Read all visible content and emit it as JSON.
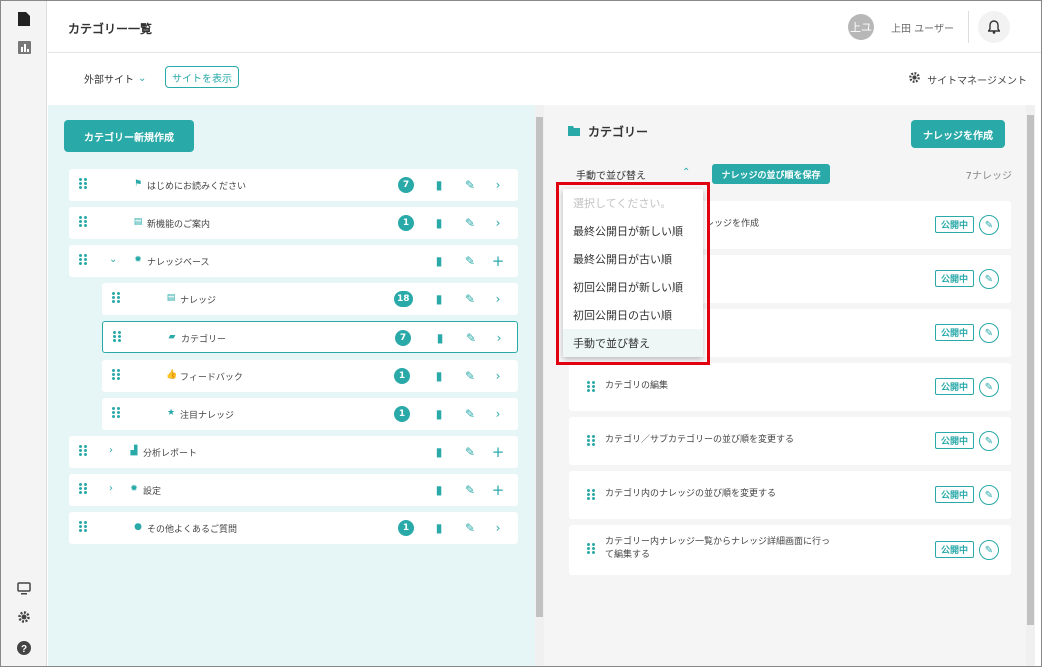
{
  "header": {
    "title": "カテゴリー一覧",
    "avatar_initials": "上ユ",
    "user_name": "上田 ユーザー"
  },
  "subheader": {
    "external_site": "外部サイト",
    "show_site": "サイトを表示",
    "site_management": "サイトマネージメント"
  },
  "left_panel": {
    "new_category_button": "カテゴリー新規作成",
    "tree": [
      {
        "label": "はじめにお読みください",
        "badge": "7",
        "icon": "flag-icon"
      },
      {
        "label": "新機能のご案内",
        "badge": "1",
        "icon": "document-icon"
      },
      {
        "label": "ナレッジベース",
        "badge": "",
        "icon": "gear-icon",
        "expanded": true
      },
      {
        "label": "ナレッジ",
        "badge": "18",
        "icon": "document-icon"
      },
      {
        "label": "カテゴリー",
        "badge": "7",
        "icon": "folder-icon",
        "selected": true
      },
      {
        "label": "フィードバック",
        "badge": "1",
        "icon": "thumbs-up-icon"
      },
      {
        "label": "注目ナレッジ",
        "badge": "1",
        "icon": "star-icon"
      },
      {
        "label": "分析レポート",
        "badge": "",
        "icon": "bar-chart-icon",
        "expanded": false
      },
      {
        "label": "設定",
        "badge": "",
        "icon": "gear-icon",
        "expanded": false
      },
      {
        "label": "その他よくあるご質問",
        "badge": "1",
        "icon": "question-icon"
      }
    ]
  },
  "right_panel": {
    "heading": "カテゴリー",
    "create_knowledge_button": "ナレッジを作成",
    "sort_selected": "手動で並び替え",
    "save_order_button": "ナレッジの並び順を保存",
    "knowledge_count": "7ナレッジ",
    "items": [
      {
        "title": "レッジを作成",
        "status": "公開中"
      },
      {
        "title": "",
        "status": "公開中"
      },
      {
        "title": "",
        "status": "公開中"
      },
      {
        "title": "カテゴリの編集",
        "status": "公開中"
      },
      {
        "title": "カテゴリ／サブカテゴリーの並び順を変更する",
        "status": "公開中"
      },
      {
        "title": "カテゴリ内のナレッジの並び順を変更する",
        "status": "公開中"
      },
      {
        "title": "カテゴリー内ナレッジ一覧からナレッジ詳細画面に行って編集する",
        "status": "公開中"
      }
    ]
  },
  "sort_dropdown": {
    "placeholder": "選択してください。",
    "options": [
      "最終公開日が新しい順",
      "最終公開日が古い順",
      "初回公開日が新しい順",
      "初回公開日の古い順",
      "手動で並び替え"
    ]
  },
  "colors": {
    "accent": "#2aa9a9",
    "highlight": "#e1000f",
    "left_panel_bg": "#e6f5f5"
  }
}
